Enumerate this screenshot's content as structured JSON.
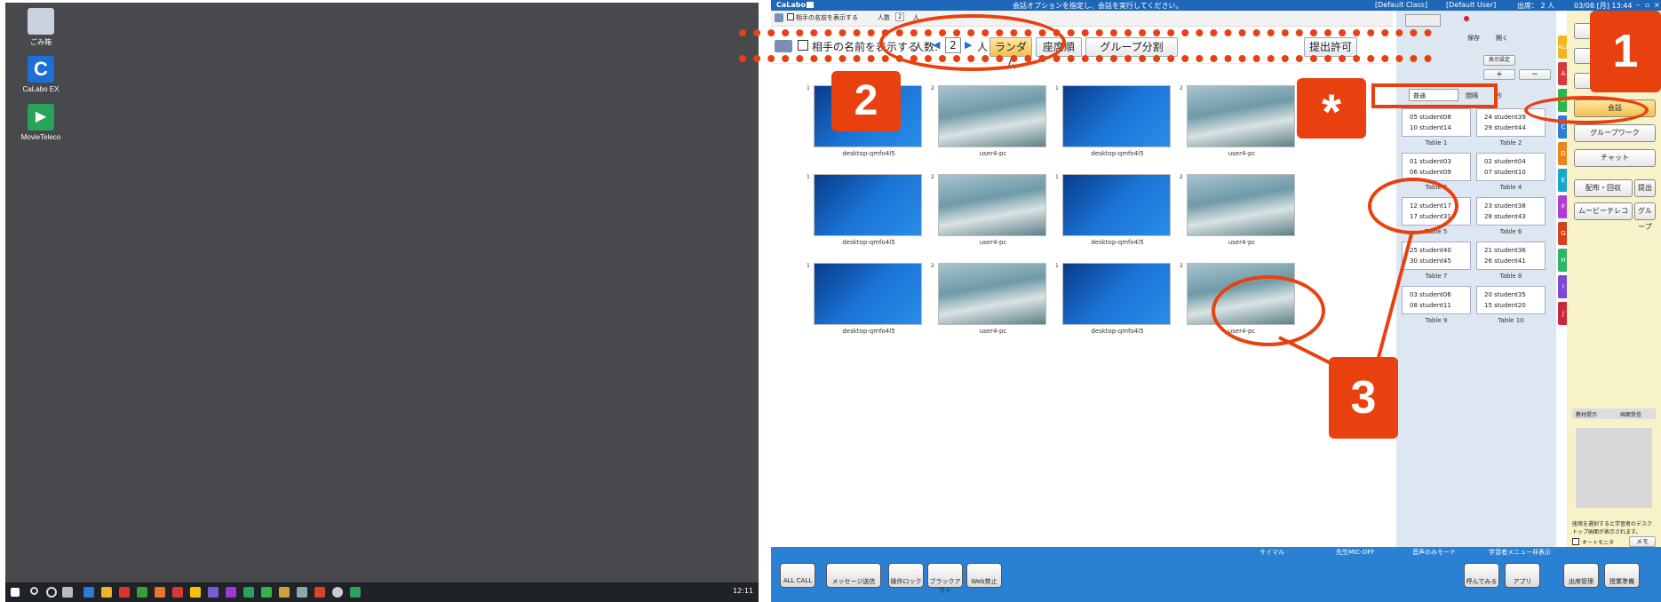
{
  "desktop": {
    "icons": [
      {
        "label": "ごみ箱",
        "icon": "recycle-bin-icon"
      },
      {
        "label": "CaLabo EX",
        "icon": "calabo-icon"
      },
      {
        "label": "MovieTeleco",
        "icon": "movieteleco-icon"
      }
    ],
    "clock": "12:11"
  },
  "app": {
    "title": "CaLabo",
    "title_message": "会話オプションを指定し、会話を実行してください。",
    "class": "[Default Class]",
    "user": "[Default User]",
    "attendance": "出席： 2 人",
    "datetime": "03/08 [月] 13:44",
    "toolbar_small": {
      "show_name": "相手の名前を表示する",
      "count_label": "人数",
      "count": "2",
      "unit": "人"
    },
    "toolbar_main": {
      "show_name": "相手の名前を表示する",
      "count_label": "人数:",
      "count": "2",
      "unit": "人",
      "random": "ランダム",
      "seat_order": "座席順",
      "group_split": "グループ分割",
      "submit_permit": "提出許可"
    },
    "thumbnails": [
      {
        "num": "1",
        "label": "desktop-qmfo4l5",
        "style": "blue"
      },
      {
        "num": "2",
        "label": "user4-pc",
        "style": "sea"
      },
      {
        "num": "1",
        "label": "desktop-qmfo4l5",
        "style": "blue"
      },
      {
        "num": "2",
        "label": "user4-pc",
        "style": "sea"
      },
      {
        "num": "1",
        "label": "desktop-qmfo4l5",
        "style": "blue"
      },
      {
        "num": "2",
        "label": "user4-pc",
        "style": "sea"
      },
      {
        "num": "1",
        "label": "desktop-qmfo4l5",
        "style": "blue"
      },
      {
        "num": "2",
        "label": "user4-pc",
        "style": "sea"
      },
      {
        "num": "1",
        "label": "desktop-qmfo4l5",
        "style": "blue"
      },
      {
        "num": "2",
        "label": "user4-pc",
        "style": "sea"
      },
      {
        "num": "1",
        "label": "desktop-qmfo4l5",
        "style": "blue"
      },
      {
        "num": "2",
        "label": "user4-pc",
        "style": "sea"
      }
    ],
    "seat_controls": {
      "save": "保存",
      "open": "開く",
      "display": "表示設定",
      "plus": "+",
      "minus": "−",
      "normal": "普通",
      "interval": "間隔",
      "seconds": "秒"
    },
    "tables": [
      {
        "name": "Table 1",
        "s1": "05 student08",
        "s2": "10 student14"
      },
      {
        "name": "Table 2",
        "s1": "24 student39",
        "s2": "29 student44"
      },
      {
        "name": "Table 3",
        "s1": "01 student03",
        "s2": "06 student09"
      },
      {
        "name": "Table 4",
        "s1": "02 student04",
        "s2": "07 student10"
      },
      {
        "name": "Table 5",
        "s1": "12 student17",
        "s2": "17 student31"
      },
      {
        "name": "Table 6",
        "s1": "23 student38",
        "s2": "28 student43"
      },
      {
        "name": "Table 7",
        "s1": "25 student40",
        "s2": "30 student45"
      },
      {
        "name": "Table 8",
        "s1": "21 student36",
        "s2": "26 student41"
      },
      {
        "name": "Table 9",
        "s1": "03 student06",
        "s2": "08 student11"
      },
      {
        "name": "Table 10",
        "s1": "20 student35",
        "s2": "15 student20"
      }
    ],
    "group_tabs": [
      "ALL",
      "A",
      "B",
      "C",
      "D",
      "E",
      "F",
      "G",
      "H",
      "I",
      "J"
    ],
    "side_buttons": {
      "conversation": "会話",
      "groupwork": "グループワーク",
      "chat": "チャット",
      "distribute": "配布・回収",
      "submit": "提出",
      "movieteleco": "ムービーテレコ",
      "group": "グループ"
    },
    "side_tabs": {
      "material": "教材提示",
      "screen": "画面受信"
    },
    "side_hint": "座席を選択すると学習者のデスクトップ画面が表示されます。",
    "auto_monitor": "オートモニタ",
    "memo": "メモ",
    "status_options": [
      "サイマル",
      "先生MIC-OFF",
      "音声のみモード",
      "学習者メニュー非表示"
    ],
    "bottom_buttons": [
      "ALL CALL",
      "メッセージ送信",
      "操作ロック",
      "ブラックアウト",
      "Web禁止"
    ],
    "bottom_right_buttons": [
      "呼んでみる",
      "アプリ",
      "出席管理",
      "授業準備"
    ]
  },
  "annotations": {
    "n1": "1",
    "n2": "2",
    "n3": "3",
    "star": "*"
  }
}
